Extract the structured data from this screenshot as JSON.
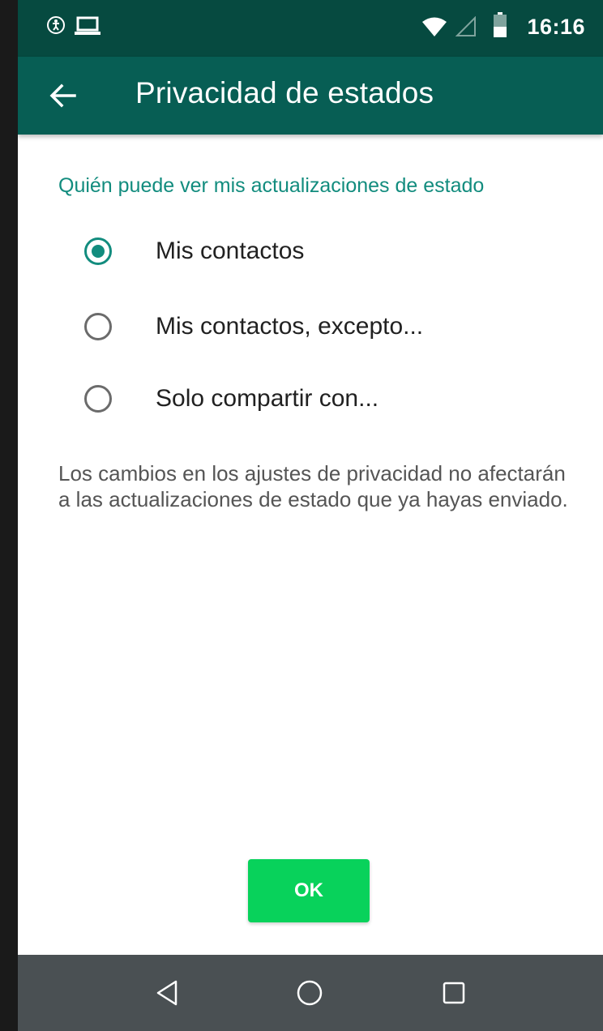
{
  "status_bar": {
    "time": "16:16",
    "left_icons": [
      "accessibility-icon",
      "laptop-icon"
    ],
    "right_icons": [
      "wifi-icon",
      "signal-icon",
      "battery-icon"
    ]
  },
  "app_bar": {
    "title": "Privacidad de estados",
    "back_icon": "arrow-back-icon"
  },
  "section": {
    "header": "Quién puede ver mis actualizaciones de estado",
    "options": [
      {
        "label": "Mis contactos",
        "selected": true
      },
      {
        "label": "Mis contactos, excepto...",
        "selected": false
      },
      {
        "label": "Solo compartir con...",
        "selected": false
      }
    ],
    "info": "Los cambios en los ajustes de privacidad no afectarán a las actualizaciones de estado que ya hayas enviado."
  },
  "ok_button": {
    "label": "OK"
  },
  "nav_bar": {
    "buttons": [
      "back-triangle-icon",
      "home-circle-icon",
      "recents-square-icon"
    ]
  },
  "colors": {
    "status_bar": "#064a40",
    "app_bar": "#075e54",
    "accent": "#128c7e",
    "ok_button": "#08d25b",
    "nav_bar": "#4a5053"
  }
}
